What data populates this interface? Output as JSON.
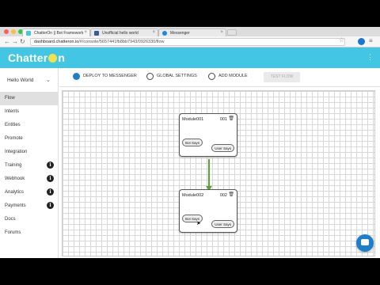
{
  "browser": {
    "tabs": [
      {
        "label": "ChatterOn || Bot Framework",
        "active": true
      },
      {
        "label": "Unofficial hello world",
        "active": false
      },
      {
        "label": "Messenger",
        "active": false
      }
    ],
    "url_host": "dashboard.chatteron.io",
    "url_path": "/#/console/5657441fb8bb7943/0926330/flow"
  },
  "app": {
    "logo": "Chatter",
    "logo_tail": "n",
    "kebab": "⋮"
  },
  "sidebar": {
    "project": "Hello World",
    "items": [
      {
        "label": "Flow",
        "active": true,
        "info": false
      },
      {
        "label": "Intents",
        "active": false,
        "info": false
      },
      {
        "label": "Entities",
        "active": false,
        "info": false
      },
      {
        "label": "Promote",
        "active": false,
        "info": false
      },
      {
        "label": "Integration",
        "active": false,
        "info": false
      },
      {
        "label": "Training",
        "active": false,
        "info": true
      },
      {
        "label": "Webhook",
        "active": false,
        "info": true
      },
      {
        "label": "Analytics",
        "active": false,
        "info": true
      },
      {
        "label": "Payments",
        "active": false,
        "info": true
      },
      {
        "label": "Docs",
        "active": false,
        "info": false
      },
      {
        "label": "Forums",
        "active": false,
        "info": false
      }
    ],
    "info_glyph": "i"
  },
  "toolbar": {
    "deploy": "DEPLOY TO MESSENGER",
    "settings": "GLOBAL SETTINGS",
    "add_module": "ADD MODULE",
    "test_flow": "TEST FLOW"
  },
  "modules": [
    {
      "name": "Module001",
      "number": "001",
      "bot_says": "Bot Says",
      "user_says": "User Says"
    },
    {
      "name": "Module002",
      "number": "002",
      "bot_says": "Bot Says",
      "user_says": "User Says"
    }
  ],
  "colors": {
    "header": "#42c6e3",
    "connector": "#5aa231",
    "chat_button": "#1e7fc8"
  }
}
